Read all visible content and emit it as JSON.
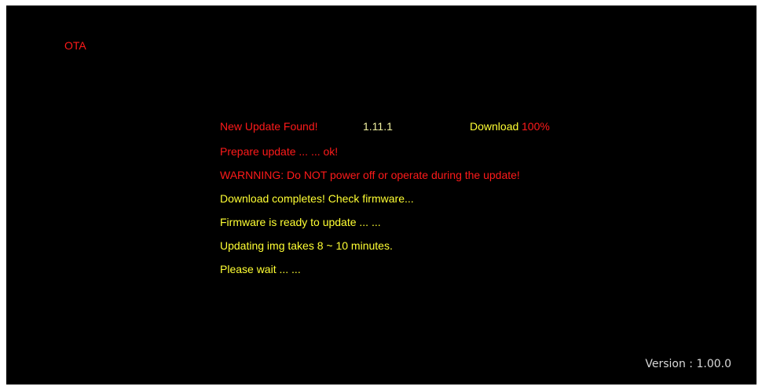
{
  "header": {
    "title": "OTA"
  },
  "status": {
    "found_label": "New  Update Found!",
    "new_version": "1.11.1",
    "download_label": "Download",
    "download_progress": "100%",
    "colors": {
      "warning": "#ff1a1a",
      "info": "#ffff33"
    }
  },
  "log": {
    "lines": [
      "Prepare update ... ... ok!",
      "WARNNING: Do NOT power off or operate during the update!",
      "Download completes! Check firmware...",
      "Firmware is ready to update ... ...",
      "Updating img takes 8 ~ 10 minutes.",
      "Please wait ... ..."
    ]
  },
  "footer": {
    "version": "Version : 1.00.0"
  }
}
